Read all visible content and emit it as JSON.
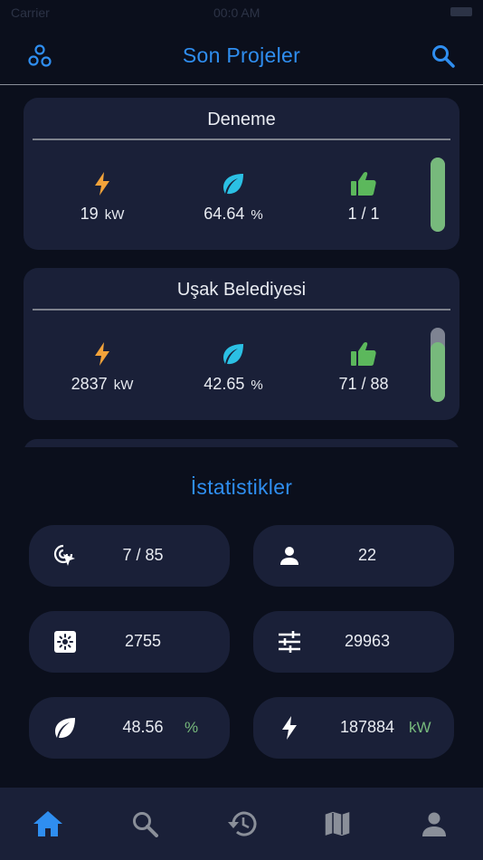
{
  "status_bar": {
    "carrier": "Carrier",
    "time": "00:0 AM"
  },
  "header": {
    "title": "Son Projeler"
  },
  "projects": [
    {
      "name": "Deneme",
      "power_value": "19",
      "power_unit": "kW",
      "eco_value": "64.64",
      "eco_unit": "%",
      "approval": "1 / 1",
      "progress": 1.0
    },
    {
      "name": "Uşak Belediyesi",
      "power_value": "2837",
      "power_unit": "kW",
      "eco_value": "42.65",
      "eco_unit": "%",
      "approval": "71 / 88",
      "progress": 0.81
    }
  ],
  "stats": {
    "title": "İstatistikler",
    "items": [
      {
        "icon": "touch-target-icon",
        "value": "7 / 85",
        "unit": ""
      },
      {
        "icon": "person-icon",
        "value": "22",
        "unit": ""
      },
      {
        "icon": "panel-icon",
        "value": "2755",
        "unit": ""
      },
      {
        "icon": "sliders-icon",
        "value": "29963",
        "unit": ""
      },
      {
        "icon": "leaf-icon",
        "value": "48.56",
        "unit": "%"
      },
      {
        "icon": "bolt-icon",
        "value": "187884",
        "unit": "kW"
      }
    ]
  },
  "tabbar": {
    "items": [
      {
        "icon": "home-icon",
        "active": true
      },
      {
        "icon": "search-icon",
        "active": false
      },
      {
        "icon": "history-icon",
        "active": false
      },
      {
        "icon": "map-icon",
        "active": false
      },
      {
        "icon": "profile-icon",
        "active": false
      }
    ]
  },
  "colors": {
    "accent": "#2f8ef0",
    "card": "#1a2038",
    "background": "#0b0f1c",
    "bolt": "#f3a33a",
    "leaf": "#2bc0e4",
    "thumb": "#5cb85c",
    "unit_green": "#77b97c"
  }
}
